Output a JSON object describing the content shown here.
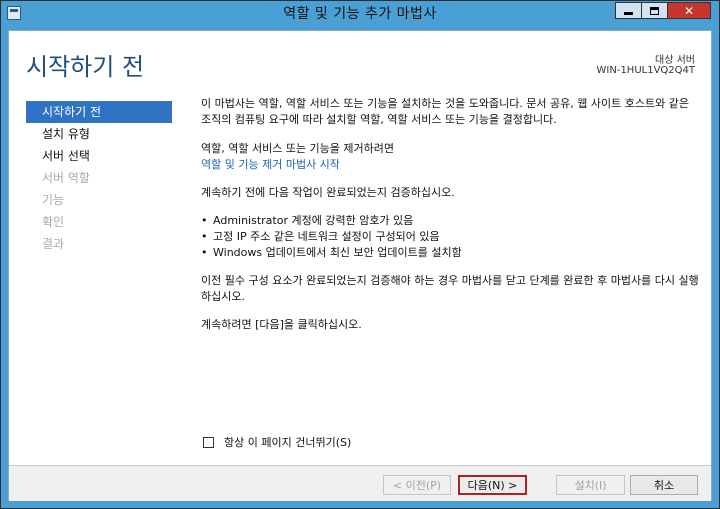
{
  "window": {
    "title": "역할 및 기능 추가 마법사"
  },
  "header": {
    "page_title": "시작하기 전",
    "destination_label": "대상 서버",
    "destination_server": "WIN-1HUL1VQ2Q4T"
  },
  "nav": {
    "items": [
      {
        "label": "시작하기 전",
        "state": "active"
      },
      {
        "label": "설치 유형",
        "state": "enabled"
      },
      {
        "label": "서버 선택",
        "state": "enabled"
      },
      {
        "label": "서버 역할",
        "state": "disabled"
      },
      {
        "label": "기능",
        "state": "disabled"
      },
      {
        "label": "확인",
        "state": "disabled"
      },
      {
        "label": "결과",
        "state": "disabled"
      }
    ]
  },
  "content": {
    "intro": "이 마법사는 역할, 역할 서비스 또는 기능을 설치하는 것을 도와줍니다. 문서 공유, 웹 사이트 호스트와 같은 조직의 컴퓨팅 요구에 따라 설치할 역할, 역할 서비스 또는 기능을 결정합니다.",
    "remove_text": "역할, 역할 서비스 또는 기능을 제거하려면",
    "remove_link": "역할 및 기능 제거 마법사 시작",
    "verify_text": "계속하기 전에 다음 작업이 완료되었는지 검증하십시오.",
    "bullets": [
      "Administrator 계정에 강력한 암호가 있음",
      "고정 IP 주소 같은 네트워크 설정이 구성되어 있음",
      "Windows 업데이트에서 최신 보안 업데이트를 설치함"
    ],
    "prereq_text": "이전 필수 구성 요소가 완료되었는지 검증해야 하는 경우 마법사를 닫고 단계를 완료한 후 마법사를 다시 실행하십시오.",
    "continue_text": "계속하려면 [다음]을 클릭하십시오."
  },
  "skip": {
    "label": "항상 이 페이지 건너뛰기(S)",
    "checked": false
  },
  "footer": {
    "prev_label": "< 이전(P)",
    "next_label": "다음(N) >",
    "install_label": "설치(I)",
    "cancel_label": "취소"
  },
  "colors": {
    "titlebar": "#4a9fd4",
    "nav_active": "#2f74c4",
    "page_title": "#1f4f82",
    "link": "#1b63b5",
    "close_button": "#c7352e",
    "primary_border": "#a92525"
  }
}
